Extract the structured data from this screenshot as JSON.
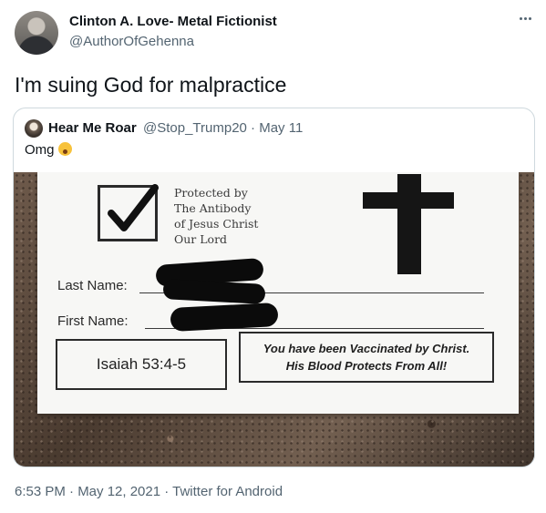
{
  "tweet": {
    "author_name": "Clinton A. Love- Metal Fictionist",
    "author_handle": "@AuthorOfGehenna",
    "text": "I'm suing God for malpractice",
    "footer": "6:53 PM · May 12, 2021 · Twitter for Android"
  },
  "quote": {
    "author_name": "Hear Me Roar",
    "meta": "@Stop_Trump20 · May 11",
    "text": "Omg",
    "emoji": "exploding-head-emoji"
  },
  "card": {
    "protected_lines": [
      "Protected by",
      "The Antibody",
      "of Jesus Christ",
      "Our Lord"
    ],
    "last_name_label": "Last Name:",
    "first_name_label": "First Name:",
    "verse": "Isaiah 53:4-5",
    "message_line1": "You have been Vaccinated by Christ.",
    "message_line2": "His Blood Protects From All!"
  },
  "colors": {
    "text_primary": "#0f1419",
    "text_secondary": "#536471",
    "border": "#cfd9de"
  }
}
